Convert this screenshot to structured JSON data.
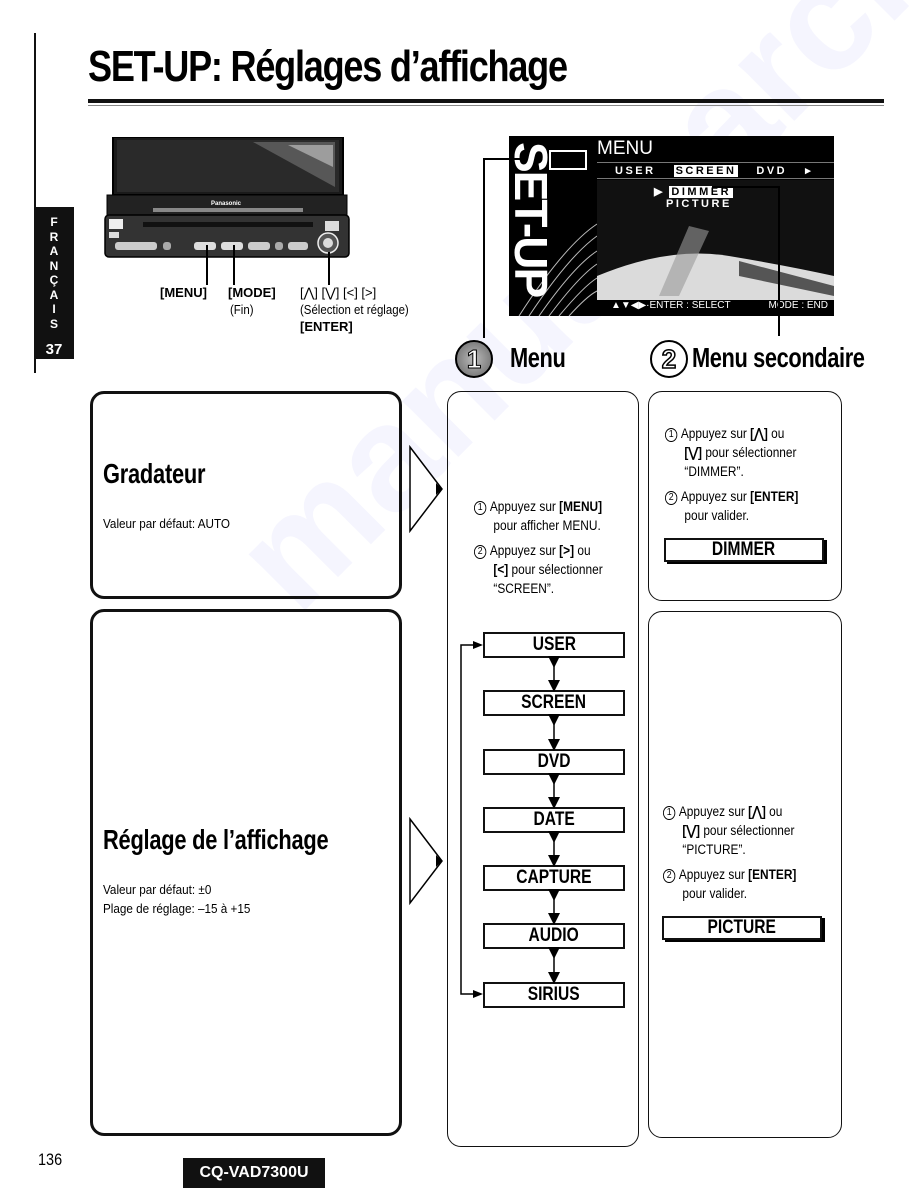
{
  "page": {
    "title": "SET-UP: Réglages d’affichage",
    "language_tab": {
      "letters": [
        "F",
        "R",
        "A",
        "N",
        "Ç",
        "A",
        "I",
        "S"
      ],
      "chapter_number": "37"
    },
    "page_number": "136",
    "model": "CQ-VAD7300U",
    "watermark": "manualsarchive"
  },
  "device": {
    "brand": "Panasonic",
    "buttons": {
      "menu": "[MENU]",
      "mode": "[MODE]",
      "mode_sub": "(Fin)",
      "arrows": "[⋀] [⋁] [<] [>]",
      "arrows_sub": "(Sélection et réglage)",
      "enter": "[ENTER]"
    }
  },
  "screen": {
    "side_label": "SET-UP",
    "menu_title": "MENU",
    "tabs": [
      "USER",
      "SCREEN",
      "DVD"
    ],
    "active_tab": "SCREEN",
    "left_arrow": "◂",
    "right_arrow": "▸",
    "submenu": [
      "DIMMER",
      "PICTURE"
    ],
    "active_submenu": "DIMMER",
    "submenu_marker": "▶",
    "footer_left": "▲▼◀▶·ENTER : SELECT",
    "footer_right": "MODE : END"
  },
  "sections": {
    "menu": {
      "number": "1",
      "title": "Menu"
    },
    "submenu": {
      "number": "2",
      "title": "Menu secondaire"
    }
  },
  "settings": [
    {
      "title": "Gradateur",
      "lines": [
        "Valeur par défaut: AUTO"
      ]
    },
    {
      "title": "Réglage de l’affichage",
      "lines": [
        "Valeur par défaut: ±0",
        "Plage de réglage: –15 à +15"
      ]
    }
  ],
  "menu_instructions": {
    "step1_num": "1",
    "step1_a": "Appuyez sur ",
    "step1_key": "[MENU]",
    "step1_b": "pour afficher MENU.",
    "step2_num": "2",
    "step2_a": "Appuyez sur ",
    "step2_key": "[>]",
    "step2_b": " ou",
    "step2_key2": "[<]",
    "step2_c": " pour sélectionner",
    "step2_d": "“SCREEN”."
  },
  "menu_cycle": [
    "USER",
    "SCREEN",
    "DVD",
    "DATE",
    "CAPTURE",
    "AUDIO",
    "SIRIUS"
  ],
  "submenu_instructions": [
    {
      "step1_num": "1",
      "step1_a": "Appuyez sur ",
      "step1_key": "[⋀]",
      "step1_b": " ou",
      "step1_key2": "[⋁]",
      "step1_c": " pour sélectionner",
      "step1_d": "“DIMMER”.",
      "step2_num": "2",
      "step2_a": "Appuyez sur ",
      "step2_key": "[ENTER]",
      "step2_b": "pour valider.",
      "result": "DIMMER"
    },
    {
      "step1_num": "1",
      "step1_a": "Appuyez sur ",
      "step1_key": "[⋀]",
      "step1_b": " ou",
      "step1_key2": "[⋁]",
      "step1_c": " pour sélectionner",
      "step1_d": "“PICTURE”.",
      "step2_num": "2",
      "step2_a": "Appuyez sur ",
      "step2_key": "[ENTER]",
      "step2_b": "pour valider.",
      "result": "PICTURE"
    }
  ]
}
